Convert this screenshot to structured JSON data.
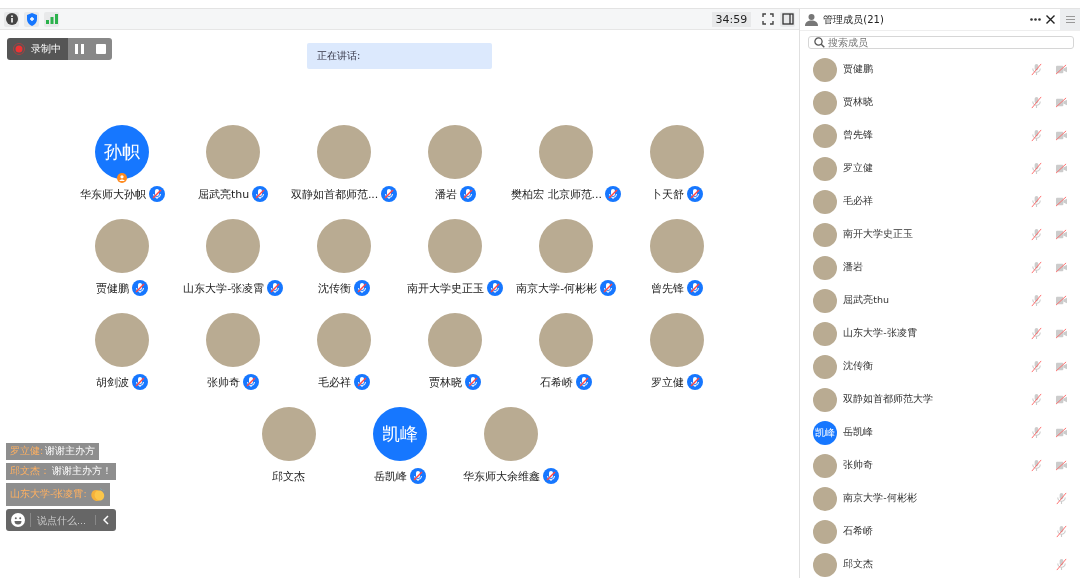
{
  "toolbar": {
    "timer": "34:59"
  },
  "recording": {
    "label": "录制中"
  },
  "speaking": {
    "label": "正在讲话:"
  },
  "participants": [
    {
      "name": "华东师大孙帜",
      "kind": "text",
      "avatar_text": "孙帜",
      "host": true,
      "mic": true
    },
    {
      "name": "屈武亮thu",
      "kind": "photo",
      "host": false,
      "mic": true
    },
    {
      "name": "双静如首都师范...",
      "kind": "photo",
      "host": false,
      "mic": true
    },
    {
      "name": "潘岩",
      "kind": "photo",
      "host": false,
      "mic": true
    },
    {
      "name": "樊柏宏 北京师范...",
      "kind": "photo",
      "host": false,
      "mic": true
    },
    {
      "name": "卜天舒",
      "kind": "photo",
      "host": false,
      "mic": true
    },
    {
      "name": "贾健鹏",
      "kind": "photo",
      "host": false,
      "mic": true
    },
    {
      "name": "山东大学-张凌霄",
      "kind": "photo",
      "host": false,
      "mic": true
    },
    {
      "name": "沈传衡",
      "kind": "photo",
      "host": false,
      "mic": true
    },
    {
      "name": "南开大学史正玉",
      "kind": "photo",
      "host": false,
      "mic": true
    },
    {
      "name": "南京大学-何彬彬",
      "kind": "photo",
      "host": false,
      "mic": true
    },
    {
      "name": "曾先锋",
      "kind": "photo",
      "host": false,
      "mic": true
    },
    {
      "name": "胡剑波",
      "kind": "photo",
      "host": false,
      "mic": true
    },
    {
      "name": "张帅奇",
      "kind": "photo",
      "host": false,
      "mic": true
    },
    {
      "name": "毛必祥",
      "kind": "photo",
      "host": false,
      "mic": true
    },
    {
      "name": "贾林晓",
      "kind": "photo",
      "host": false,
      "mic": true
    },
    {
      "name": "石希峤",
      "kind": "photo",
      "host": false,
      "mic": true
    },
    {
      "name": "罗立健",
      "kind": "photo",
      "host": false,
      "mic": true
    },
    {
      "name": "邱文杰",
      "kind": "photo",
      "host": false,
      "mic": false
    },
    {
      "name": "岳凯峰",
      "kind": "text",
      "avatar_text": "凯峰",
      "host": false,
      "mic": true
    },
    {
      "name": "华东师大余维鑫",
      "kind": "photo",
      "host": false,
      "mic": true
    }
  ],
  "chat": {
    "messages": [
      {
        "sender": "罗立健:",
        "text": "谢谢主办方",
        "kind": "text"
      },
      {
        "sender": "邱文杰：",
        "text": "谢谢主办方！",
        "kind": "text"
      },
      {
        "sender": "山东大学-张凌霄:",
        "kind": "emoji"
      }
    ],
    "input": {
      "placeholder": "说点什么..."
    }
  },
  "sidebar": {
    "title": "管理成员(21)",
    "search": {
      "placeholder": "搜索成员"
    },
    "members": [
      {
        "name": "贾健鹏",
        "kind": "photo",
        "video": true
      },
      {
        "name": "贾林晓",
        "kind": "photo",
        "video": true
      },
      {
        "name": "曾先锋",
        "kind": "photo",
        "video": true
      },
      {
        "name": "罗立健",
        "kind": "photo",
        "video": true
      },
      {
        "name": "毛必祥",
        "kind": "photo",
        "video": true
      },
      {
        "name": "南开大学史正玉",
        "kind": "photo",
        "video": true
      },
      {
        "name": "潘岩",
        "kind": "photo",
        "video": true
      },
      {
        "name": "屈武亮thu",
        "kind": "photo",
        "video": true
      },
      {
        "name": "山东大学-张凌霄",
        "kind": "photo",
        "video": true
      },
      {
        "name": "沈传衡",
        "kind": "photo",
        "video": true
      },
      {
        "name": "双静如首都师范大学",
        "kind": "photo",
        "video": true
      },
      {
        "name": "岳凯峰",
        "kind": "text",
        "avatar_text": "凯峰",
        "video": true
      },
      {
        "name": "张帅奇",
        "kind": "photo",
        "video": true
      },
      {
        "name": "南京大学-何彬彬",
        "kind": "photo",
        "video": false
      },
      {
        "name": "石希峤",
        "kind": "photo",
        "video": false
      },
      {
        "name": "邱文杰",
        "kind": "photo",
        "video": false
      }
    ]
  }
}
